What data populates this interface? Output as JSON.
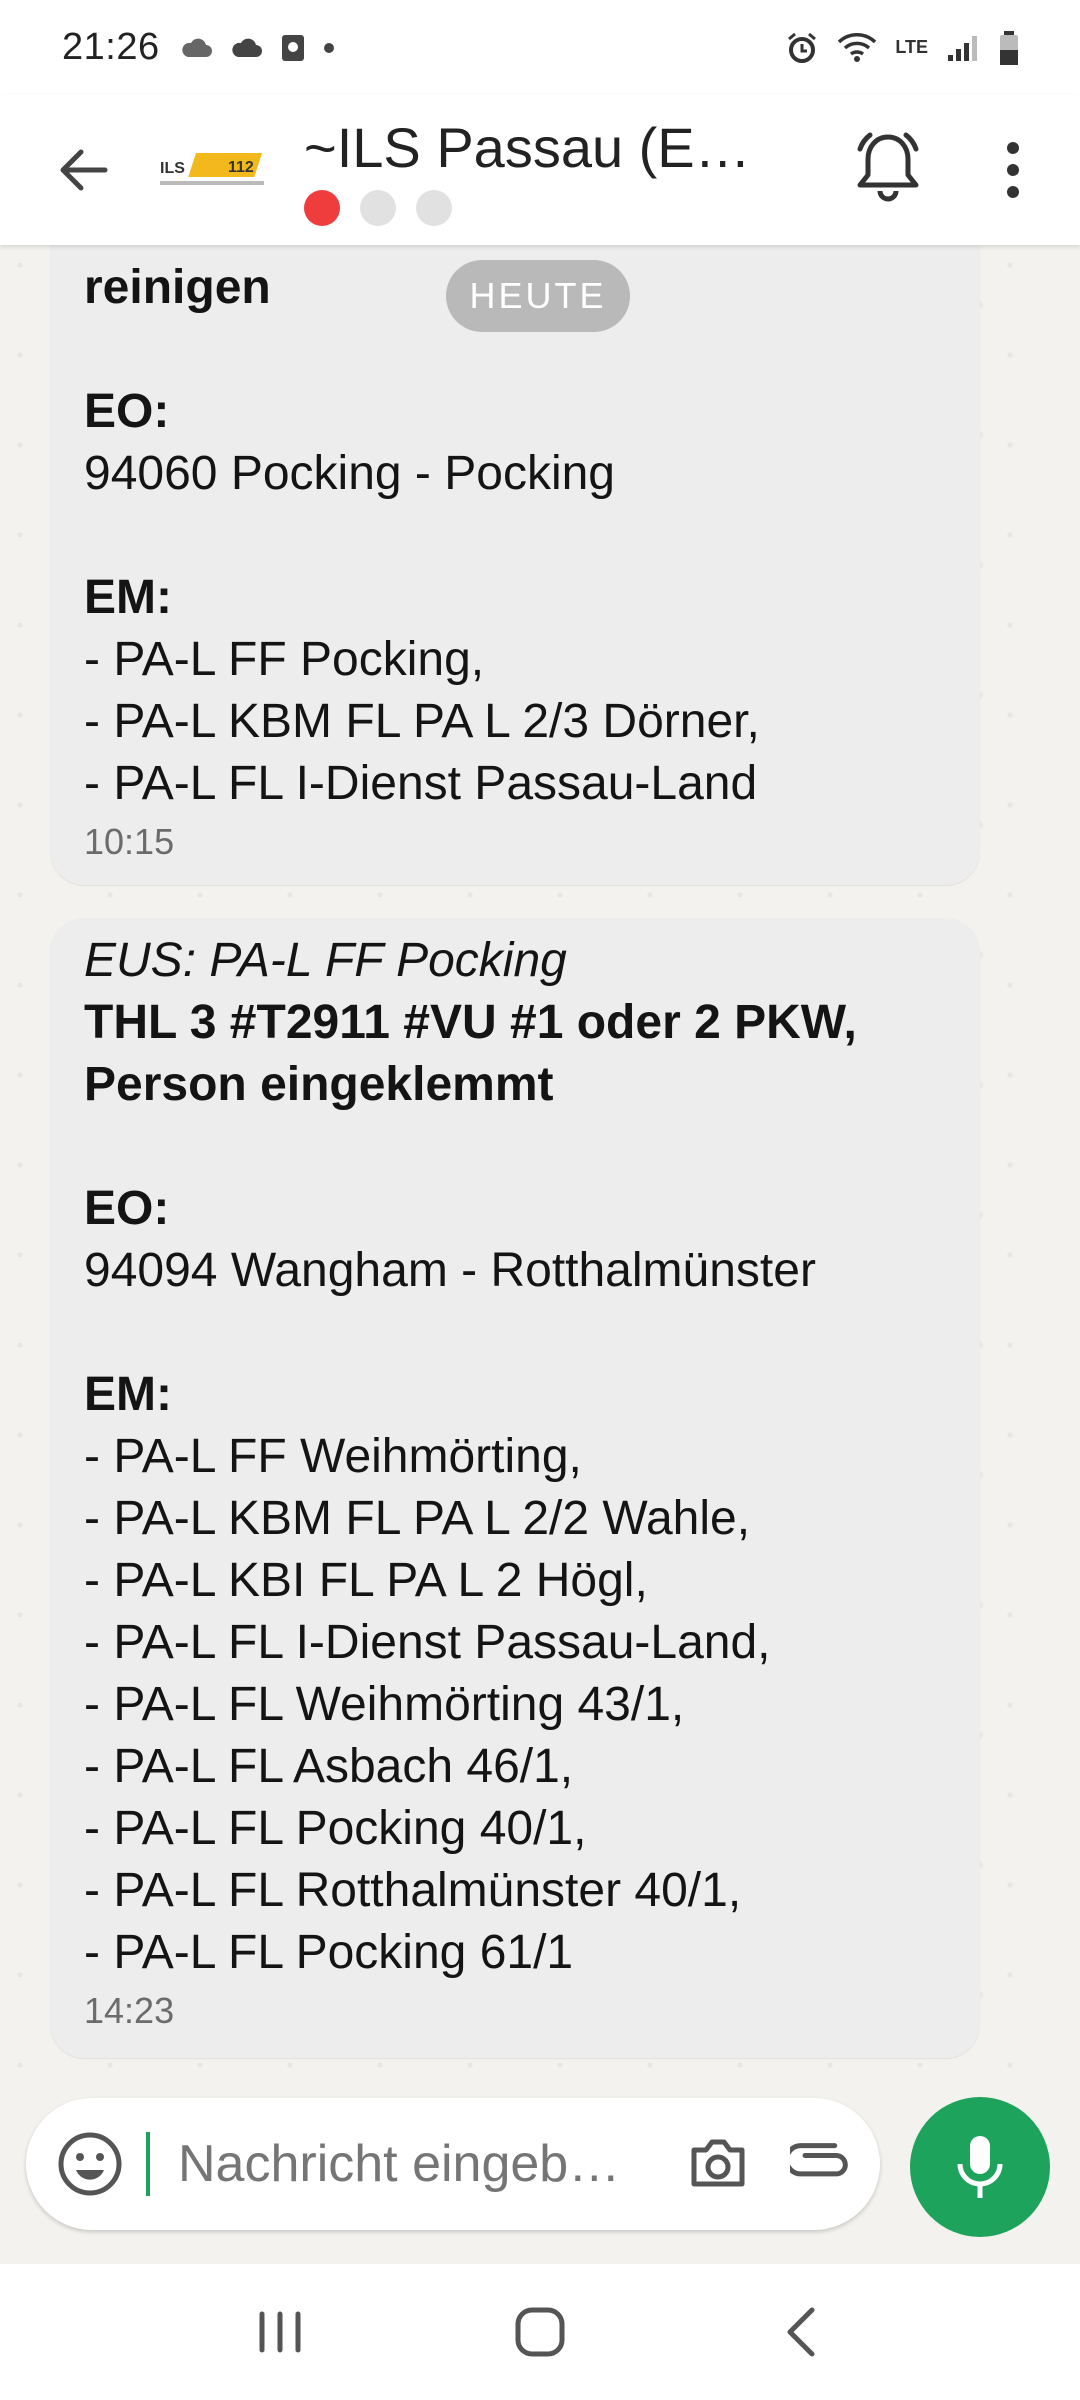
{
  "status_bar": {
    "time": "21:26",
    "network_label": "LTE"
  },
  "header": {
    "title": "~ILS Passau (E…",
    "logo_text": "ILS 112"
  },
  "date_chip": "HEUTE",
  "messages": [
    {
      "lines": [
        {
          "text": "reinigen",
          "style": "bold"
        },
        {
          "text": "",
          "style": "gap"
        },
        {
          "text": "EO:",
          "style": "bold"
        },
        {
          "text": "94060 Pocking - Pocking",
          "style": "normal"
        },
        {
          "text": "",
          "style": "gap"
        },
        {
          "text": "EM:",
          "style": "bold"
        },
        {
          "text": "- PA-L FF Pocking,",
          "style": "normal"
        },
        {
          "text": "- PA-L KBM FL PA L 2/3 Dörner,",
          "style": "normal"
        },
        {
          "text": "- PA-L FL I-Dienst Passau-Land",
          "style": "normal"
        }
      ],
      "time": "10:15"
    },
    {
      "lines": [
        {
          "text": "EUS: PA-L FF Pocking",
          "style": "italic"
        },
        {
          "text": "THL 3 #T2911 #VU #1 oder 2 PKW,",
          "style": "bold"
        },
        {
          "text": "Person eingeklemmt",
          "style": "bold"
        },
        {
          "text": "",
          "style": "gap"
        },
        {
          "text": "EO:",
          "style": "bold"
        },
        {
          "text": "94094 Wangham - Rotthalmünster",
          "style": "normal"
        },
        {
          "text": "",
          "style": "gap"
        },
        {
          "text": "EM:",
          "style": "bold"
        },
        {
          "text": "- PA-L FF Weihmörting,",
          "style": "normal"
        },
        {
          "text": "- PA-L KBM FL PA L 2/2 Wahle,",
          "style": "normal"
        },
        {
          "text": "- PA-L KBI FL PA L 2 Högl,",
          "style": "normal"
        },
        {
          "text": "- PA-L FL I-Dienst Passau-Land,",
          "style": "normal"
        },
        {
          "text": "- PA-L FL Weihmörting 43/1,",
          "style": "normal"
        },
        {
          "text": "- PA-L FL Asbach 46/1,",
          "style": "normal"
        },
        {
          "text": "- PA-L FL Pocking 40/1,",
          "style": "normal"
        },
        {
          "text": "- PA-L FL Rotthalmünster 40/1,",
          "style": "normal"
        },
        {
          "text": "- PA-L FL Pocking 61/1",
          "style": "normal"
        }
      ],
      "time": "14:23"
    }
  ],
  "composer": {
    "placeholder": "Nachricht eingeb…"
  },
  "colors": {
    "accent_green": "#1ea35c",
    "bubble_bg": "#ededee",
    "active_dot": "#ef3c3c",
    "logo_yellow": "#f3b81c"
  },
  "icons": {
    "status": [
      "cloud-icon",
      "cloud-icon",
      "screenshot-icon",
      "dot-icon",
      "alarm-icon",
      "wifi-icon",
      "signal-icon",
      "battery-icon"
    ],
    "header": [
      "back-arrow-icon",
      "bell-icon",
      "more-vert-icon"
    ],
    "composer": [
      "emoji-icon",
      "camera-icon",
      "attach-icon",
      "mic-icon"
    ],
    "navbar": [
      "recents-icon",
      "home-icon",
      "back-icon"
    ]
  }
}
